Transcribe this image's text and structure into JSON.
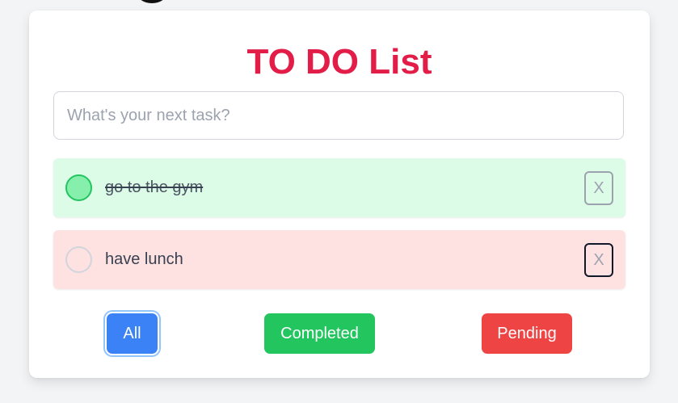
{
  "app": {
    "title": "TO DO List"
  },
  "input": {
    "placeholder": "What's your next task?",
    "value": ""
  },
  "todos": [
    {
      "text": "go to the gym",
      "status": "completed",
      "delete_label": "X"
    },
    {
      "text": "have lunch",
      "status": "pending",
      "delete_label": "X"
    }
  ],
  "filters": {
    "all_label": "All",
    "completed_label": "Completed",
    "pending_label": "Pending",
    "active": "All"
  },
  "colors": {
    "title": "#e11d48",
    "completed_bg": "#dcfce7",
    "pending_bg": "#fee2e2",
    "all_button": "#3b82f6",
    "completed_button": "#22c55e",
    "pending_button": "#ef4444"
  }
}
